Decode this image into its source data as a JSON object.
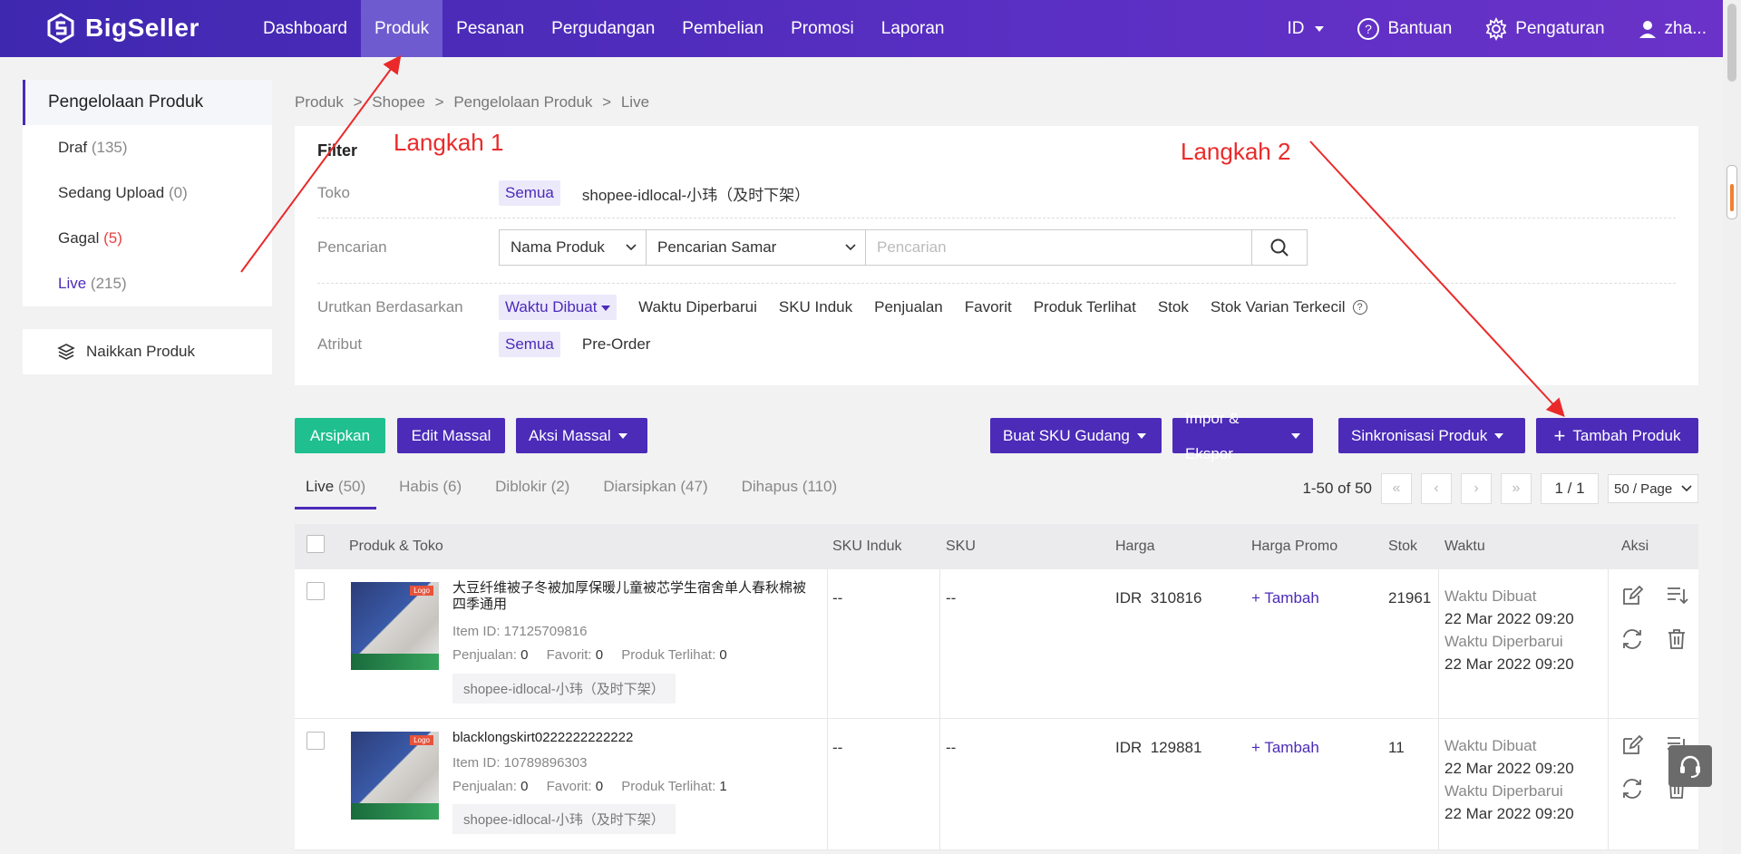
{
  "app": {
    "brand": "BigSeller"
  },
  "nav": [
    "Dashboard",
    "Produk",
    "Pesanan",
    "Pergudangan",
    "Pembelian",
    "Promosi",
    "Laporan"
  ],
  "top_right": {
    "lang": "ID",
    "help": "Bantuan",
    "settings": "Pengaturan",
    "user": "zha..."
  },
  "sidebar": {
    "title": "Pengelolaan Produk",
    "items": [
      {
        "label": "Draf",
        "count": "(135)"
      },
      {
        "label": "Sedang Upload",
        "count": "(0)"
      },
      {
        "label": "Gagal",
        "count": "(5)"
      },
      {
        "label": "Live",
        "count": "(215)"
      }
    ],
    "upload": "Naikkan Produk"
  },
  "breadcrumb": [
    "Produk",
    ">",
    "Shopee",
    ">",
    "Pengelolaan Produk",
    ">",
    "Live"
  ],
  "filter": {
    "title": "Filter",
    "store_label": "Toko",
    "store_all": "Semua",
    "store_name": "shopee-idlocal-小玮（及时下架）",
    "search_label": "Pencarian",
    "search_field": "Nama Produk",
    "search_mode": "Pencarian Samar",
    "search_placeholder": "Pencarian",
    "sort_label": "Urutkan Berdasarkan",
    "sort_active": "Waktu Dibuat",
    "sort_options": [
      "Waktu Diperbarui",
      "SKU Induk",
      "Penjualan",
      "Favorit",
      "Produk Terlihat",
      "Stok",
      "Stok Varian Terkecil"
    ],
    "attr_label": "Atribut",
    "attr_all": "Semua",
    "attr_option": "Pre-Order"
  },
  "actions": {
    "archive": "Arsipkan",
    "bulk_edit": "Edit Massal",
    "bulk_action": "Aksi Massal",
    "create_sku": "Buat SKU Gudang",
    "import_export": "Impor & Ekspor",
    "sync": "Sinkronisasi Produk",
    "add_product": "Tambah Produk"
  },
  "tabs": [
    {
      "label": "Live",
      "count": "(50)"
    },
    {
      "label": "Habis",
      "count": "(6)"
    },
    {
      "label": "Diblokir",
      "count": "(2)"
    },
    {
      "label": "Diarsipkan",
      "count": "(47)"
    },
    {
      "label": "Dihapus",
      "count": "(110)"
    }
  ],
  "pager": {
    "range": "1-50 of 50",
    "page": "1 / 1",
    "per_page": "50 / Page"
  },
  "table": {
    "headers": [
      "Produk & Toko",
      "SKU Induk",
      "SKU",
      "Harga",
      "Harga Promo",
      "Stok",
      "Waktu",
      "Aksi"
    ],
    "rows": [
      {
        "name": "大豆纤维被子冬被加厚保暖儿童被芯学生宿舍单人春秋棉被四季通用",
        "item_id": "Item ID: 17125709816",
        "sales_label": "Penjualan:",
        "sales": "0",
        "fav_label": "Favorit:",
        "fav": "0",
        "views_label": "Produk Terlihat:",
        "views": "0",
        "store": "shopee-idlocal-小玮（及时下架）",
        "sku_parent": "--",
        "sku": "--",
        "price": "IDR  310816",
        "promo": "+ Tambah",
        "stock": "21961",
        "created_label": "Waktu Dibuat",
        "created": "22 Mar 2022 09:20",
        "updated_label": "Waktu Diperbarui",
        "updated": "22 Mar 2022 09:20"
      },
      {
        "name": "blacklongskirt0222222222222",
        "item_id": "Item ID: 10789896303",
        "sales_label": "Penjualan:",
        "sales": "0",
        "fav_label": "Favorit:",
        "fav": "0",
        "views_label": "Produk Terlihat:",
        "views": "1",
        "store": "shopee-idlocal-小玮（及时下架）",
        "sku_parent": "--",
        "sku": "--",
        "price": "IDR  129881",
        "promo": "+ Tambah",
        "stock": "11",
        "created_label": "Waktu Dibuat",
        "created": "22 Mar 2022 09:20",
        "updated_label": "Waktu Diperbarui",
        "updated": "22 Mar 2022 09:20"
      }
    ]
  },
  "annotations": {
    "step1": "Langkah 1",
    "step2": "Langkah 2"
  },
  "colors": {
    "brand": "#4b2bb8",
    "green": "#1fbf8f",
    "annotation": "#ea2a2a"
  }
}
